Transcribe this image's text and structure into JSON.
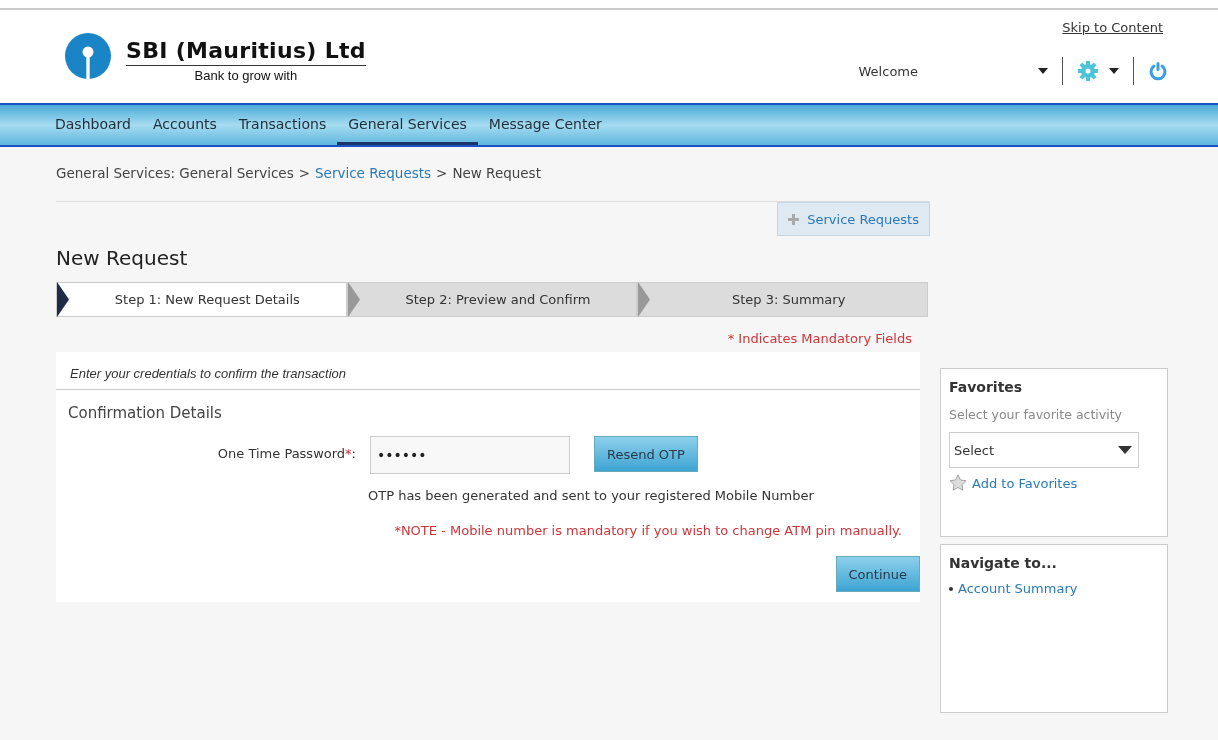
{
  "header": {
    "logo_title": "SBI (Mauritius) Ltd",
    "tagline": "Bank to grow with",
    "skip_link": "Skip to Content",
    "welcome": "Welcome"
  },
  "nav": [
    {
      "label": "Dashboard",
      "selected": false
    },
    {
      "label": "Accounts",
      "selected": false
    },
    {
      "label": "Transactions",
      "selected": false
    },
    {
      "label": "General Services",
      "selected": true
    },
    {
      "label": "Message Center",
      "selected": false
    }
  ],
  "breadcrumb": [
    {
      "text": "General Services: General Services",
      "link": false
    },
    {
      "text": ">",
      "link": false
    },
    {
      "text": "Service Requests",
      "link": true
    },
    {
      "text": ">",
      "link": false
    },
    {
      "text": "New Request",
      "link": false
    }
  ],
  "service_requests_button": "Service Requests",
  "page_title": "New Request",
  "steps": [
    {
      "label": "Step 1: New Request Details",
      "selected": true
    },
    {
      "label": "Step 2: Preview and Confirm",
      "selected": false
    },
    {
      "label": "Step 3: Summary",
      "selected": false
    }
  ],
  "mandatory_note": "* Indicates Mandatory Fields",
  "panel": {
    "instruction": "Enter your credentials to confirm the transaction",
    "section_title": "Confirmation Details",
    "otp_label": "One Time Password",
    "required_mark": "*",
    "label_colon": ":",
    "otp_value": "••••••",
    "resend_button": "Resend OTP",
    "otp_message": "OTP has been generated and sent to your registered Mobile Number",
    "note": "*NOTE - Mobile number is mandatory if you wish to change ATM pin manually.",
    "continue_button": "Continue"
  },
  "favorites": {
    "title": "Favorites",
    "hint": "Select your favorite activity",
    "select_value": "Select",
    "add_link": "Add to Favorites"
  },
  "navigate": {
    "title": "Navigate to...",
    "links": [
      "Account Summary"
    ]
  }
}
